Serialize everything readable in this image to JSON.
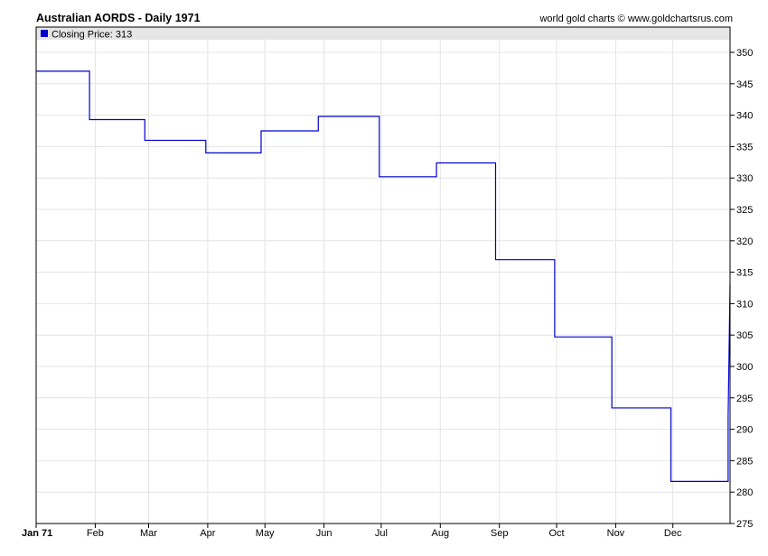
{
  "header": {
    "title": "Australian AORDS - Daily 1971",
    "credit": "world gold charts © www.goldchartsrus.com"
  },
  "legend": {
    "label": "Closing Price: 313",
    "color": "#0000cc"
  },
  "chart_data": {
    "type": "line",
    "style": "step",
    "title": "Australian AORDS - Daily 1971",
    "xlabel": "",
    "ylabel": "",
    "ylim": [
      275,
      350
    ],
    "yticks": [
      275,
      280,
      285,
      290,
      295,
      300,
      305,
      310,
      315,
      320,
      325,
      330,
      335,
      340,
      345,
      350
    ],
    "y_axis_position": "right",
    "xlim": [
      "1971-01-01",
      "1971-12-31"
    ],
    "xticks": [
      {
        "date": "1971-01-01",
        "label": "Jan 71",
        "bold": true
      },
      {
        "date": "1971-02-01",
        "label": "Feb"
      },
      {
        "date": "1971-03-01",
        "label": "Mar"
      },
      {
        "date": "1971-04-01",
        "label": "Apr"
      },
      {
        "date": "1971-05-01",
        "label": "May"
      },
      {
        "date": "1971-06-01",
        "label": "Jun"
      },
      {
        "date": "1971-07-01",
        "label": "Jul"
      },
      {
        "date": "1971-08-01",
        "label": "Aug"
      },
      {
        "date": "1971-09-01",
        "label": "Sep"
      },
      {
        "date": "1971-10-01",
        "label": "Oct"
      },
      {
        "date": "1971-11-01",
        "label": "Nov"
      },
      {
        "date": "1971-12-01",
        "label": "Dec"
      }
    ],
    "grid": true,
    "legend_position": "top-left",
    "series": [
      {
        "name": "Closing Price",
        "color": "#0000cc",
        "x": [
          "1971-01-01",
          "1971-01-29",
          "1971-02-27",
          "1971-03-31",
          "1971-04-29",
          "1971-05-29",
          "1971-06-30",
          "1971-07-30",
          "1971-08-30",
          "1971-09-30",
          "1971-10-30",
          "1971-11-30",
          "1971-12-30",
          "1971-12-31"
        ],
        "values": [
          347,
          339.3,
          336,
          334,
          337.5,
          339.8,
          330.2,
          332.4,
          317,
          304.7,
          293.4,
          281.7,
          292,
          313
        ]
      }
    ]
  }
}
